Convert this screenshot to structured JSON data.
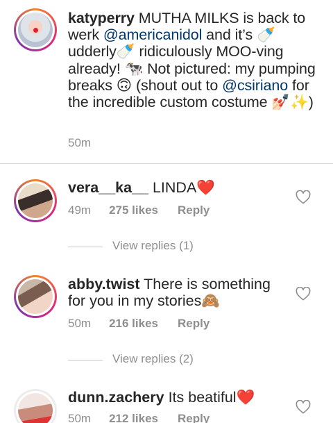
{
  "caption": {
    "username": "katyperry",
    "text_1": " MUTHA MILKS is back to werk ",
    "mention_1": "@americanidol",
    "text_2": " and it’s 🍼 udderly🍼 ridiculously MOO-ving already! 🐄 Not pictured: my pumping breaks 🙃 (shout out to ",
    "mention_2": "@csiriano",
    "text_3": " for the incredible custom costume 💅🏻✨)",
    "time": "50m"
  },
  "comments": [
    {
      "username": "vera__ka__",
      "text": " LINDA❤️",
      "time": "49m",
      "likes": "275 likes",
      "reply": "Reply",
      "view_replies": "View replies (1)"
    },
    {
      "username": "abby.twist",
      "text": " There is something for you in my stories🙈",
      "time": "50m",
      "likes": "216 likes",
      "reply": "Reply",
      "view_replies": "View replies (2)"
    },
    {
      "username": "dunn.zachery",
      "text": " Its beatiful❤️",
      "time": "50m",
      "likes": "212 likes",
      "reply": "Reply"
    }
  ],
  "icons": {
    "like": "heart-outline-icon"
  }
}
